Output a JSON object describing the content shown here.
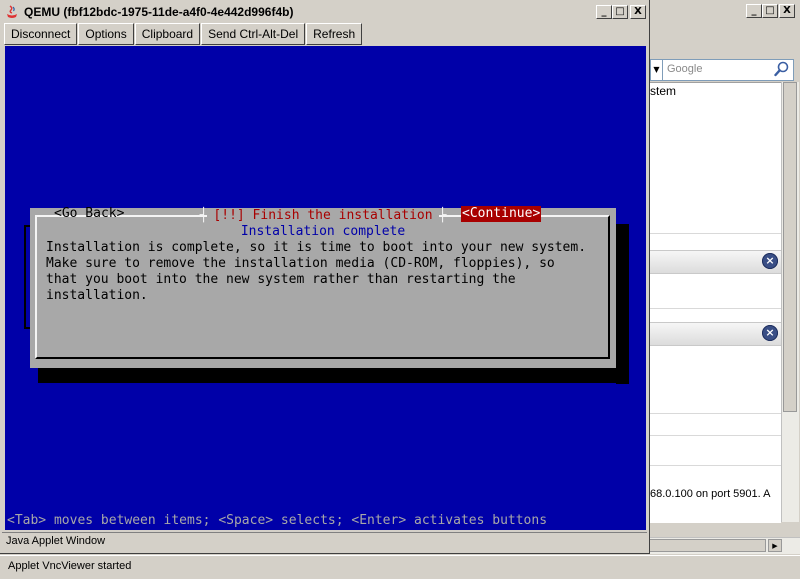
{
  "qemu_window": {
    "title": "QEMU (fbf12bdc-1975-11de-a4f0-4e442d996f4b)",
    "toolbar": [
      "Disconnect",
      "Options",
      "Clipboard",
      "Send Ctrl-Alt-Del",
      "Refresh"
    ],
    "java_status": "Java Applet Window"
  },
  "window_buttons": {
    "minimize": "_",
    "maximize": "□",
    "close": "X"
  },
  "dialog": {
    "title": "[!!] Finish the installation",
    "subtitle": "Installation complete",
    "body": "Installation is complete, so it is time to boot into your new system.\nMake sure to remove the installation media (CD-ROM, floppies), so\nthat you boot into the new system rather than restarting the\ninstallation.",
    "go_back": "<Go Back>",
    "continue": "<Continue>",
    "title_left_bracket": "┤",
    "title_right_bracket": "├"
  },
  "help_line": "<Tab> moves between items; <Space> selects; <Enter> activates buttons",
  "background_window": {
    "search_placeholder": "Google",
    "text_fragment": "stem",
    "port_text": "68.0.100 on port 5901. A",
    "bar_close_glyph": "×",
    "dropdown_glyph": "▼",
    "hscroll_arrow": "▶"
  },
  "applet_status": "Applet VncViewer started",
  "colors": {
    "screen_blue": "#0000a8",
    "dialog_gray": "#a8a8a8",
    "title_red": "#a80000",
    "button_focus_red": "#a80000"
  },
  "icons": [
    "java-icon",
    "search-icon",
    "close-icon"
  ]
}
